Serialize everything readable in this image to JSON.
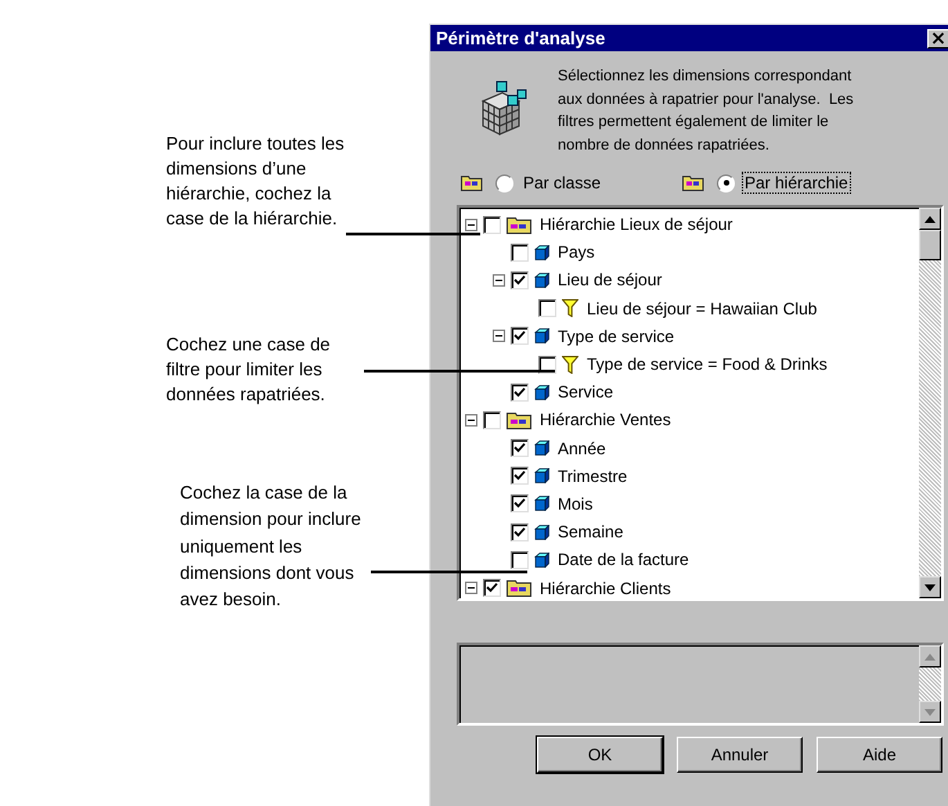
{
  "annotations": [
    {
      "text": "Pour inclure toutes les dimensions d’une hiérarchie, cochez la case de la hiérarchie."
    },
    {
      "text": "Cochez une case de filtre pour limiter les données rapatriées."
    },
    {
      "text": "Cochez la case de la dimension pour inclure uniquement les dimensions dont vous avez besoin."
    }
  ],
  "window": {
    "title": "Périmètre d'analyse",
    "close": "×"
  },
  "intro": "Sélectionnez les dimensions correspondant aux données à rapatrier pour l'analyse.  Les filtres permettent également de limiter le nombre de données rapatriées.",
  "view_options": [
    {
      "label": "Par classe",
      "selected": false
    },
    {
      "label": "Par hiérarchie",
      "selected": true
    }
  ],
  "tree": [
    {
      "label": "Hiérarchie Lieux de séjour",
      "kind": "hierarchy",
      "checked": false,
      "expanded": true,
      "children": [
        {
          "label": "Pays",
          "kind": "dimension",
          "checked": false
        },
        {
          "label": "Lieu de séjour",
          "kind": "dimension",
          "checked": true,
          "expanded": true,
          "children": [
            {
              "label": "Lieu de séjour = Hawaiian Club",
              "kind": "filter",
              "checked": false
            }
          ]
        },
        {
          "label": "Type de service",
          "kind": "dimension",
          "checked": true,
          "expanded": true,
          "children": [
            {
              "label": "Type de service = Food & Drinks",
              "kind": "filter",
              "checked": false
            }
          ]
        },
        {
          "label": "Service",
          "kind": "dimension",
          "checked": true
        }
      ]
    },
    {
      "label": "Hiérarchie Ventes",
      "kind": "hierarchy",
      "checked": false,
      "expanded": true,
      "children": [
        {
          "label": "Année",
          "kind": "dimension",
          "checked": true
        },
        {
          "label": "Trimestre",
          "kind": "dimension",
          "checked": true
        },
        {
          "label": "Mois",
          "kind": "dimension",
          "checked": true
        },
        {
          "label": "Semaine",
          "kind": "dimension",
          "checked": true
        },
        {
          "label": "Date de la facture",
          "kind": "dimension",
          "checked": false
        }
      ]
    },
    {
      "label": "Hiérarchie Clients",
      "kind": "hierarchy",
      "checked": true,
      "expanded": true
    }
  ],
  "buttons": [
    "OK",
    "Annuler",
    "Aide"
  ]
}
